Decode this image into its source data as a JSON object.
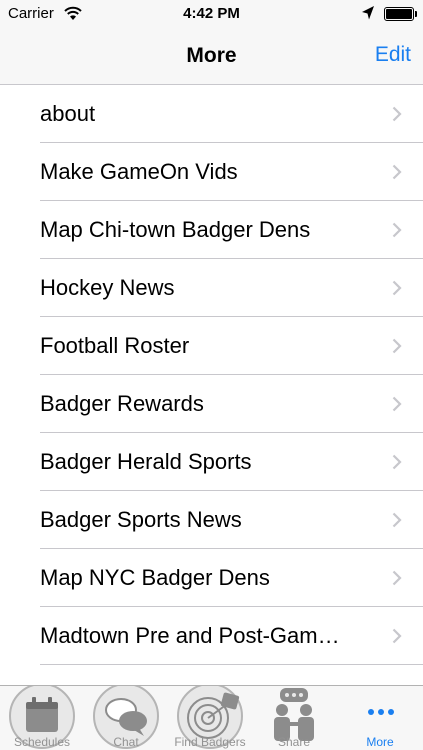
{
  "status_bar": {
    "carrier": "Carrier",
    "time": "4:42 PM",
    "icons": [
      "wifi-icon",
      "location-icon",
      "battery-icon"
    ]
  },
  "nav_bar": {
    "title": "More",
    "edit_label": "Edit"
  },
  "list": {
    "items": [
      {
        "label": "about"
      },
      {
        "label": "Make GameOn Vids"
      },
      {
        "label": "Map Chi-town Badger Dens"
      },
      {
        "label": "Hockey News"
      },
      {
        "label": "Football Roster"
      },
      {
        "label": "Badger Rewards"
      },
      {
        "label": "Badger Herald Sports"
      },
      {
        "label": "Badger Sports News"
      },
      {
        "label": "Map NYC Badger Dens"
      },
      {
        "label": "Madtown Pre and Post-Gam…"
      }
    ]
  },
  "tab_bar": {
    "tabs": [
      {
        "label": "Schedules",
        "icon": "calendar-icon",
        "active": false
      },
      {
        "label": "Chat",
        "icon": "chat-bubbles-icon",
        "active": false
      },
      {
        "label": "Find Badgers",
        "icon": "radar-icon",
        "active": false
      },
      {
        "label": "Share",
        "icon": "people-share-icon",
        "active": false
      },
      {
        "label": "More",
        "icon": "more-dots-icon",
        "active": true
      }
    ]
  },
  "colors": {
    "accent": "#1a7ff0",
    "inactive_tab": "#929292",
    "separator": "#c8c7cc",
    "bar_background": "#f7f7f7"
  }
}
